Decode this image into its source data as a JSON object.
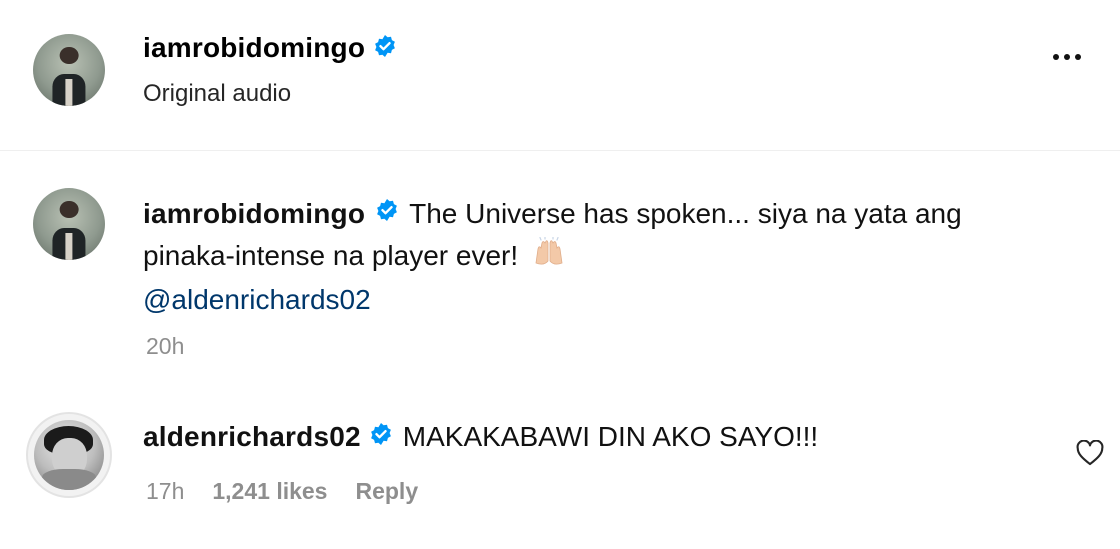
{
  "header": {
    "username": "iamrobidomingo",
    "subtitle": "Original audio"
  },
  "caption": {
    "username": "iamrobidomingo",
    "text_line1": "The Universe has spoken... siya na yata ang",
    "text_line2": "pinaka-intense na player ever!",
    "emoji": "raising-hands-emoji",
    "mention": "@aldenrichards02",
    "time": "20h"
  },
  "comment": {
    "username": "aldenrichards02",
    "text": "MAKAKABAWI DIN AKO SAYO!!!",
    "time": "17h",
    "likes": "1,241 likes",
    "reply_label": "Reply"
  },
  "colors": {
    "verified": "#0095f6",
    "mention": "#00376b",
    "muted": "#8e8e8e"
  }
}
